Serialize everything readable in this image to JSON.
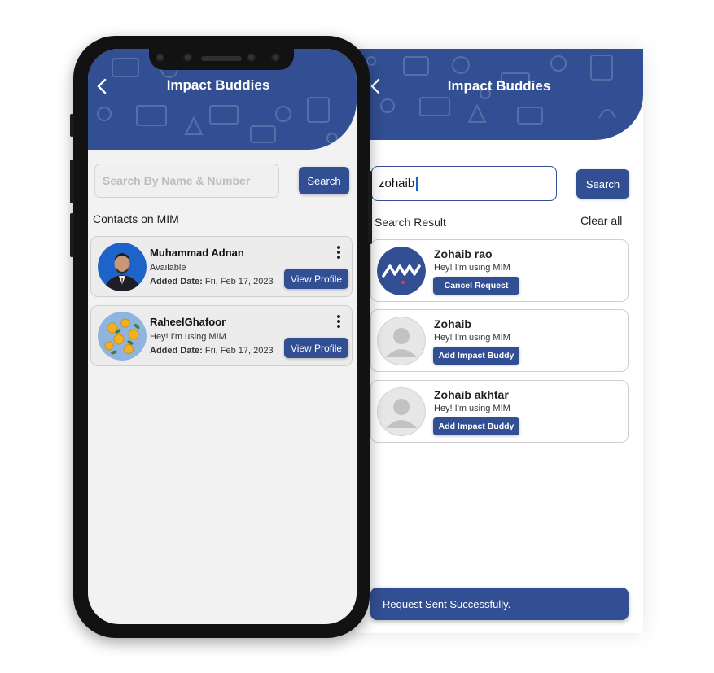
{
  "colors": {
    "primary": "#324f93",
    "background": "#f2f2f2",
    "text": "#222222"
  },
  "left_screen": {
    "title": "Impact Buddies",
    "back_icon": "chevron-left-icon",
    "search": {
      "placeholder": "Search By Name & Number",
      "value": ""
    },
    "search_button": "Search",
    "section_label": "Contacts on MIM",
    "contacts": [
      {
        "name": "Muhammad Adnan",
        "status": "Available",
        "added_label": "Added Date:",
        "added_date": "Fri, Feb 17, 2023",
        "button": "View Profile",
        "avatar_icon": "person-photo-avatar",
        "menu_icon": "more-vertical-icon"
      },
      {
        "name": "RaheelGhafoor",
        "status": "Hey! I'm using M!M",
        "added_label": "Added Date:",
        "added_date": "Fri, Feb 17, 2023",
        "button": "View Profile",
        "avatar_icon": "lemons-photo-avatar",
        "menu_icon": "more-vertical-icon"
      }
    ]
  },
  "right_screen": {
    "title": "Impact Buddies",
    "back_icon": "chevron-left-icon",
    "search": {
      "value": "zohaib"
    },
    "search_button": "Search",
    "results_label": "Search Result",
    "clear_label": "Clear all",
    "results": [
      {
        "name": "Zohaib rao",
        "status": "Hey! I'm using M!M",
        "button": "Cancel Request",
        "avatar_icon": "mim-logo-avatar"
      },
      {
        "name": "Zohaib",
        "status": "Hey! I'm using M!M",
        "button": "Add Impact Buddy",
        "avatar_icon": "default-user-avatar"
      },
      {
        "name": "Zohaib akhtar",
        "status": "Hey! I'm using M!M",
        "button": "Add Impact Buddy",
        "avatar_icon": "default-user-avatar"
      }
    ],
    "toast": "Request Sent Successfully."
  }
}
